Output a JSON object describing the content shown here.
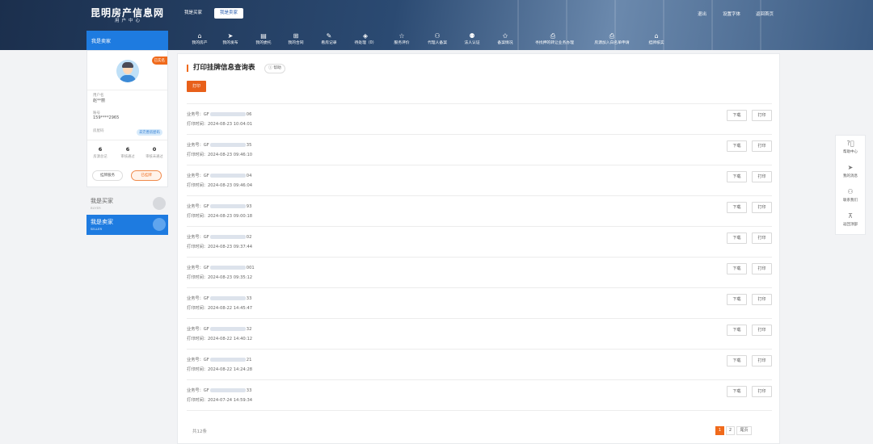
{
  "header": {
    "site_title": "昆明房产信息网",
    "site_subtitle": "用户中心",
    "role_buyer": "我是买家",
    "role_seller": "我是卖家",
    "top_links": [
      "退出",
      "设置字体",
      "返回首页"
    ]
  },
  "nav": {
    "items": [
      {
        "label": "我的房产",
        "icon": "home-icon"
      },
      {
        "label": "我的发布",
        "icon": "send-icon"
      },
      {
        "label": "我的委托",
        "icon": "document-icon"
      },
      {
        "label": "我的合同",
        "icon": "grid-icon"
      },
      {
        "label": "看房记录",
        "icon": "pencil-icon"
      },
      {
        "label": "待处理（0）",
        "icon": "layers-icon"
      },
      {
        "label": "服务评价",
        "icon": "star-icon"
      },
      {
        "label": "代理人备案",
        "icon": "person-icon"
      },
      {
        "label": "法人认证",
        "icon": "users-icon"
      },
      {
        "label": "备案情况",
        "icon": "star-outline-icon"
      },
      {
        "label": "寻找押的转让业务办理",
        "icon": "print-icon"
      },
      {
        "label": "房源加入白名单申请",
        "icon": "print-icon"
      },
      {
        "label": "挂牌核实",
        "icon": "home-icon"
      }
    ]
  },
  "sidebar": {
    "header": "我是卖家",
    "badge": "已实名",
    "fields": [
      {
        "label": "用户名",
        "value": "赵**丽"
      },
      {
        "label": "账号",
        "value": "159****2965"
      },
      {
        "label": "房屋码",
        "value": ""
      }
    ],
    "pill": "去完善房屋码",
    "stats": [
      {
        "value": "6",
        "label": "房源总记"
      },
      {
        "value": "6",
        "label": "审核通过"
      },
      {
        "value": "0",
        "label": "审核未通过"
      }
    ],
    "btn_left": "挂牌服务",
    "btn_right": "已挂牌",
    "role_buyer_title": "我是买家",
    "role_buyer_sub": "BUYER",
    "role_seller_title": "我是卖家",
    "role_seller_sub": "SELLER"
  },
  "main": {
    "title": "打印挂牌信息查询表",
    "help": "帮助",
    "print_button": "打印",
    "biz_label": "业务号：",
    "time_label": "打印时间：",
    "download": "下载",
    "print": "打印",
    "rows": [
      {
        "prefix": "GF",
        "suffix": "06",
        "time": "2024-08-23 10:04:01"
      },
      {
        "prefix": "GF",
        "suffix": "35",
        "time": "2024-08-23 09:46:10"
      },
      {
        "prefix": "GF",
        "suffix": "04",
        "time": "2024-08-23 09:46:04"
      },
      {
        "prefix": "GF",
        "suffix": "93",
        "time": "2024-08-23 09:00:18"
      },
      {
        "prefix": "GF",
        "suffix": "02",
        "time": "2024-08-23 09:37:44"
      },
      {
        "prefix": "GF",
        "suffix": "001",
        "time": "2024-08-23 09:35:12"
      },
      {
        "prefix": "GF",
        "suffix": "33",
        "time": "2024-08-22 14:45:47"
      },
      {
        "prefix": "GF",
        "suffix": "32",
        "time": "2024-08-22 14:40:12"
      },
      {
        "prefix": "GF",
        "suffix": "21",
        "time": "2024-08-22 14:24:28"
      },
      {
        "prefix": "GF",
        "suffix": "33",
        "time": "2024-07-24 14:59:34"
      }
    ],
    "total": "共12条",
    "pages": [
      "1",
      "2"
    ],
    "page_last": "尾页"
  },
  "float": {
    "items": [
      {
        "label": "帮助中心",
        "icon": "question-icon"
      },
      {
        "label": "我的消息",
        "icon": "send-icon"
      },
      {
        "label": "联系我们",
        "icon": "person-icon"
      },
      {
        "label": "返回顶部",
        "icon": "arrow-up-icon"
      }
    ]
  }
}
